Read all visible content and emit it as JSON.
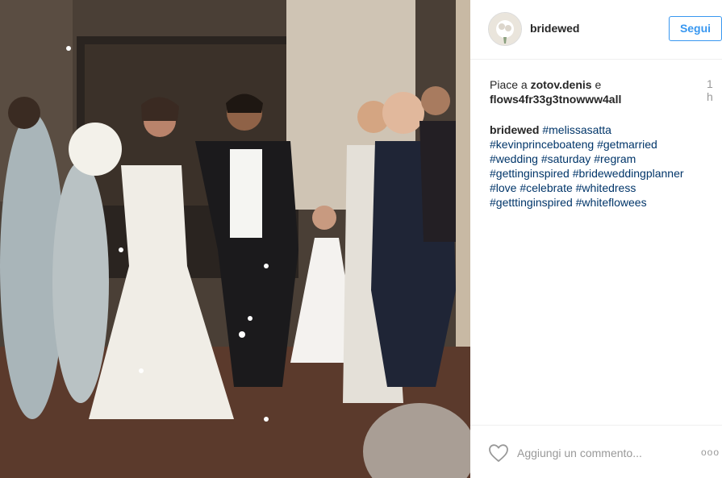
{
  "post": {
    "photo_alt": "wedding photo",
    "username": "bridewed",
    "follow_label": "Segui",
    "likes_prefix": "Piace a ",
    "liker_1": "zotov.denis",
    "likes_joiner": " e",
    "liker_2": "flows4fr33g3tnowww4all",
    "time": "1 h",
    "caption_author": "bridewed",
    "hashtags": [
      "#melissasatta",
      "#kevinprinceboateng",
      "#getmarried",
      "#wedding",
      "#saturday",
      "#regram",
      "#gettinginspired",
      "#brideweddingplanner",
      "#love",
      "#celebrate",
      "#whitedress",
      "#getttinginspired",
      "#whiteflowees"
    ],
    "comment_placeholder": "Aggiungi un commento...",
    "more_label": "ooo",
    "colors": {
      "accent": "#3897f0",
      "hashtag": "#003569",
      "muted": "#999999",
      "text": "#262626"
    },
    "icons": {
      "like": "heart-outline-icon",
      "more": "more-options-icon"
    }
  }
}
